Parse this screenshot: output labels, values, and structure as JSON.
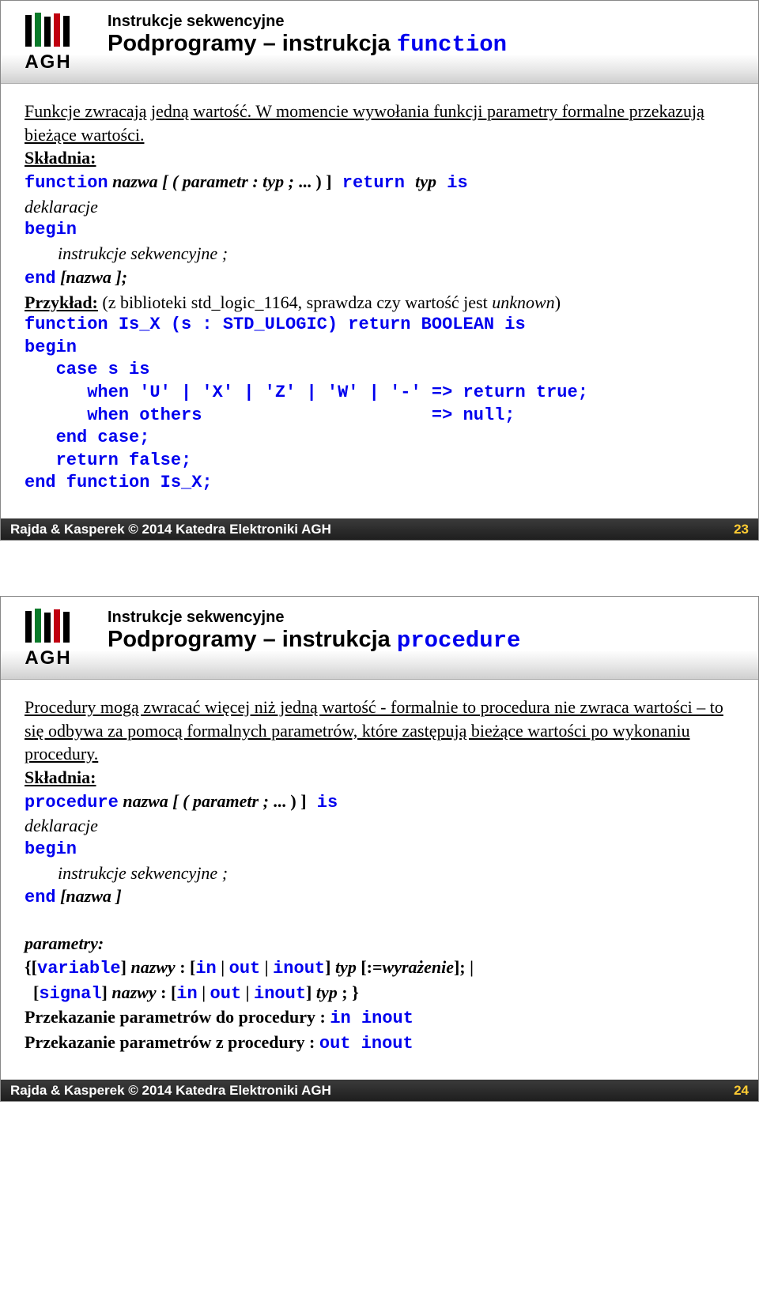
{
  "common": {
    "header_pretitle": "Instrukcje sekwencyjne",
    "logo_text": "AGH",
    "footer_copyright": "Rajda & Kasperek © 2014 Katedra Elektroniki AGH"
  },
  "slide23": {
    "title_prefix": "Podprogramy – instrukcja ",
    "title_keyword": "function",
    "intro": "Funkcje zwracają jedną wartość. W momencie wywołania funkcji parametry formalne przekazują bieżące wartości.",
    "syntax_label": "Składnia:",
    "syntax": {
      "l1_kw": "function",
      "l1_rest": " nazwa  [ ( parametr :  typ ;",
      "l1_tail_plain": " ... ) ]",
      "l1_tail_kw": " return ",
      "l1_tail2": "typ",
      "l1_tail3": " is",
      "l2": "deklaracje",
      "l3_kw": "begin",
      "l4": "instrukcje sekwencyjne ;",
      "l5_kw": "end",
      "l5_rest": " [nazwa ];"
    },
    "example_label": "Przykład:",
    "example_desc": " (z biblioteki std_logic_1164, sprawdza czy wartość jest ",
    "example_unknown": "unknown",
    "example_close": ")",
    "code": "function Is_X (s : STD_ULOGIC) return BOOLEAN is\nbegin\n   case s is\n      when 'U' | 'X' | 'Z' | 'W' | '-' => return true;\n      when others                      => null;\n   end case;\n   return false;\nend function Is_X;",
    "page": "23"
  },
  "slide24": {
    "title_prefix": "Podprogramy – instrukcja ",
    "title_keyword": "procedure",
    "intro": "Procedury mogą zwracać więcej niż jedną wartość - formalnie to procedura nie zwraca wartości – to się odbywa za pomocą formalnych parametrów, które zastępują bieżące wartości po wykonaniu procedury.",
    "syntax_label": "Składnia:",
    "syntax": {
      "l1_kw": "procedure",
      "l1_rest": " nazwa  [ ( parametr ;",
      "l1_tail_plain": " ... ) ]",
      "l1_tail_kw": " is",
      "l2": "deklaracje",
      "l3_kw": "begin",
      "l4": "instrukcje sekwencyjne ;",
      "l5_kw": "end",
      "l5_rest": " [nazwa ]"
    },
    "params_label": "parametry:",
    "params_l1_pre": "{[",
    "params_l1_kw1": "variable",
    "params_l1_mid": "] ",
    "params_l1_it": "nazwy",
    "params_l1_colon": " :  [",
    "params_l1_in": "in",
    "params_l1_pipe1": " | ",
    "params_l1_out": "out",
    "params_l1_pipe2": " | ",
    "params_l1_inout": "inout",
    "params_l1_after": "] ",
    "params_l1_typ": "typ",
    "params_l1_assign": " [:=",
    "params_l1_wyraz": "wyrażenie",
    "params_l1_end": "];  |",
    "params_l2_pre": "  [",
    "params_l2_kw": "signal",
    "params_l2_mid": "] ",
    "params_l2_it": "nazwy",
    "params_l2_colon": " :  [",
    "params_l2_in": "in",
    "params_l2_pipe1": " | ",
    "params_l2_out": "out",
    "params_l2_pipe2": " | ",
    "params_l2_inout": "inout",
    "params_l2_after": "] ",
    "params_l2_typ": "typ",
    "params_l2_end": " ; }",
    "pass_in_label": "Przekazanie parametrów do procedury : ",
    "pass_in_kw": "in inout",
    "pass_out_label": "Przekazanie parametrów z procedury : ",
    "pass_out_kw": "out inout",
    "page": "24"
  }
}
